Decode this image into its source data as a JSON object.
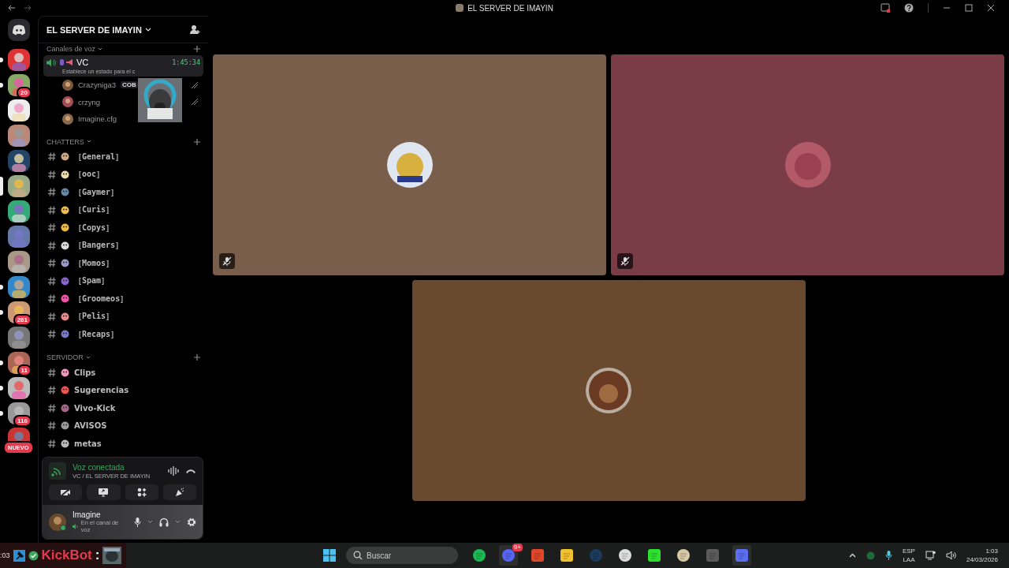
{
  "window": {
    "title": "EL SERVER DE IMAYIN"
  },
  "servers": [
    {
      "unread": true,
      "selected": false
    },
    {
      "unread": true,
      "selected": false,
      "badge": "20"
    },
    {
      "unread": false,
      "selected": false
    },
    {
      "unread": false,
      "selected": false
    },
    {
      "unread": false,
      "selected": false
    },
    {
      "unread": false,
      "selected": true
    },
    {
      "unread": false,
      "selected": false
    },
    {
      "unread": false,
      "selected": false
    },
    {
      "unread": false,
      "selected": false
    },
    {
      "unread": true,
      "selected": false
    },
    {
      "unread": true,
      "selected": false,
      "badge": "281"
    },
    {
      "unread": false,
      "selected": false
    },
    {
      "unread": true,
      "selected": false,
      "badge": "11"
    },
    {
      "unread": true,
      "selected": false
    },
    {
      "unread": true,
      "selected": false,
      "badge": "116"
    },
    {
      "unread": false,
      "selected": false,
      "badge": "NUEVO"
    }
  ],
  "server": {
    "name": "EL SERVER DE IMAYIN"
  },
  "categories": [
    {
      "name": "Canales de voz",
      "kind": "voice",
      "channels": [
        {
          "name": "VC",
          "timer": "1:45:34",
          "status": "Establece un estado para el c",
          "members": [
            {
              "name": "Crazyniga3",
              "tag": "COB",
              "muted": true
            },
            {
              "name": "crzyng",
              "muted": true
            },
            {
              "name": "Imagine.cfg",
              "muted": false
            }
          ]
        }
      ]
    },
    {
      "name": "CHATTERS",
      "kind": "text",
      "channels": [
        {
          "name": "［General］"
        },
        {
          "name": "［ooc］"
        },
        {
          "name": "［Gaymer］"
        },
        {
          "name": "［Curis］"
        },
        {
          "name": "［Copys］"
        },
        {
          "name": "［Bangers］"
        },
        {
          "name": "［Momos］"
        },
        {
          "name": "［Spam］"
        },
        {
          "name": "［Groomeos］"
        },
        {
          "name": "［Pelis］"
        },
        {
          "name": "［Recaps］"
        }
      ]
    },
    {
      "name": "SERVIDOR",
      "kind": "text",
      "channels": [
        {
          "name": "Clips"
        },
        {
          "name": "Sugerencias"
        },
        {
          "name": "Vivo-Kick"
        },
        {
          "name": "AVISOS"
        },
        {
          "name": "metas"
        }
      ]
    }
  ],
  "voice_panel": {
    "status": "Voz conectada",
    "location": "VC / EL SERVER DE IMAYIN"
  },
  "user": {
    "name": "Imagine",
    "status": "En el canal de voz"
  },
  "tiles": [
    {
      "color": "#7a5e4c",
      "muted": true
    },
    {
      "color": "#7a3d48",
      "muted": true
    },
    {
      "color": "#6a4a2e",
      "muted": false
    }
  ],
  "overlay_strip": {
    "time": ":03",
    "name": "KickBot",
    "separator": ":"
  },
  "taskbar": {
    "search": {
      "placeholder": "Buscar"
    },
    "discord_badge": "9+",
    "language": "ESP",
    "layout": "LAA",
    "time": "1:03",
    "date": "24/03/2026"
  }
}
